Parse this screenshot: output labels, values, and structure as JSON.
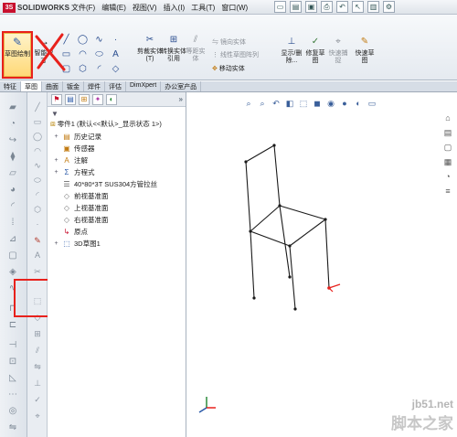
{
  "app": {
    "brand_ds": "3S",
    "brand_name": "SOLIDWORKS"
  },
  "menu": [
    "文件(F)",
    "编辑(E)",
    "视图(V)",
    "插入(I)",
    "工具(T)",
    "窗口(W)"
  ],
  "ribbon": {
    "sketch_label": "草图绘制",
    "smart_dim_label": "智能尺寸",
    "trim_label": "剪裁实体(T)",
    "convert_label": "转换实体引用",
    "offset_label": "等距实体",
    "mirror_label": "镜向实体",
    "linear_pattern_label": "线性草图阵列",
    "move_label": "移动实体",
    "display_delete_label": "显示/删除...",
    "repair_label": "修复草图",
    "quick_snap_label": "快速捕捉",
    "rapid_sketch_label": "快速草图"
  },
  "tabs": [
    "特征",
    "草图",
    "曲面",
    "钣金",
    "焊件",
    "评估",
    "DimXpert",
    "办公室产品"
  ],
  "tree": {
    "root": "零件1 (默认<<默认>_显示状态 1>)",
    "items": [
      "历史记录",
      "传感器",
      "注解",
      "方程式",
      "40*80*3T  SUS304方管拉丝",
      "前视基准面",
      "上视基准面",
      "右视基准面",
      "原点",
      "3D草图1"
    ]
  },
  "watermark": {
    "url": "jb51.net",
    "name": "脚本之家"
  },
  "colors": {
    "annotation_red": "#e8211c",
    "active_sketch_bg": "#ffd978"
  }
}
